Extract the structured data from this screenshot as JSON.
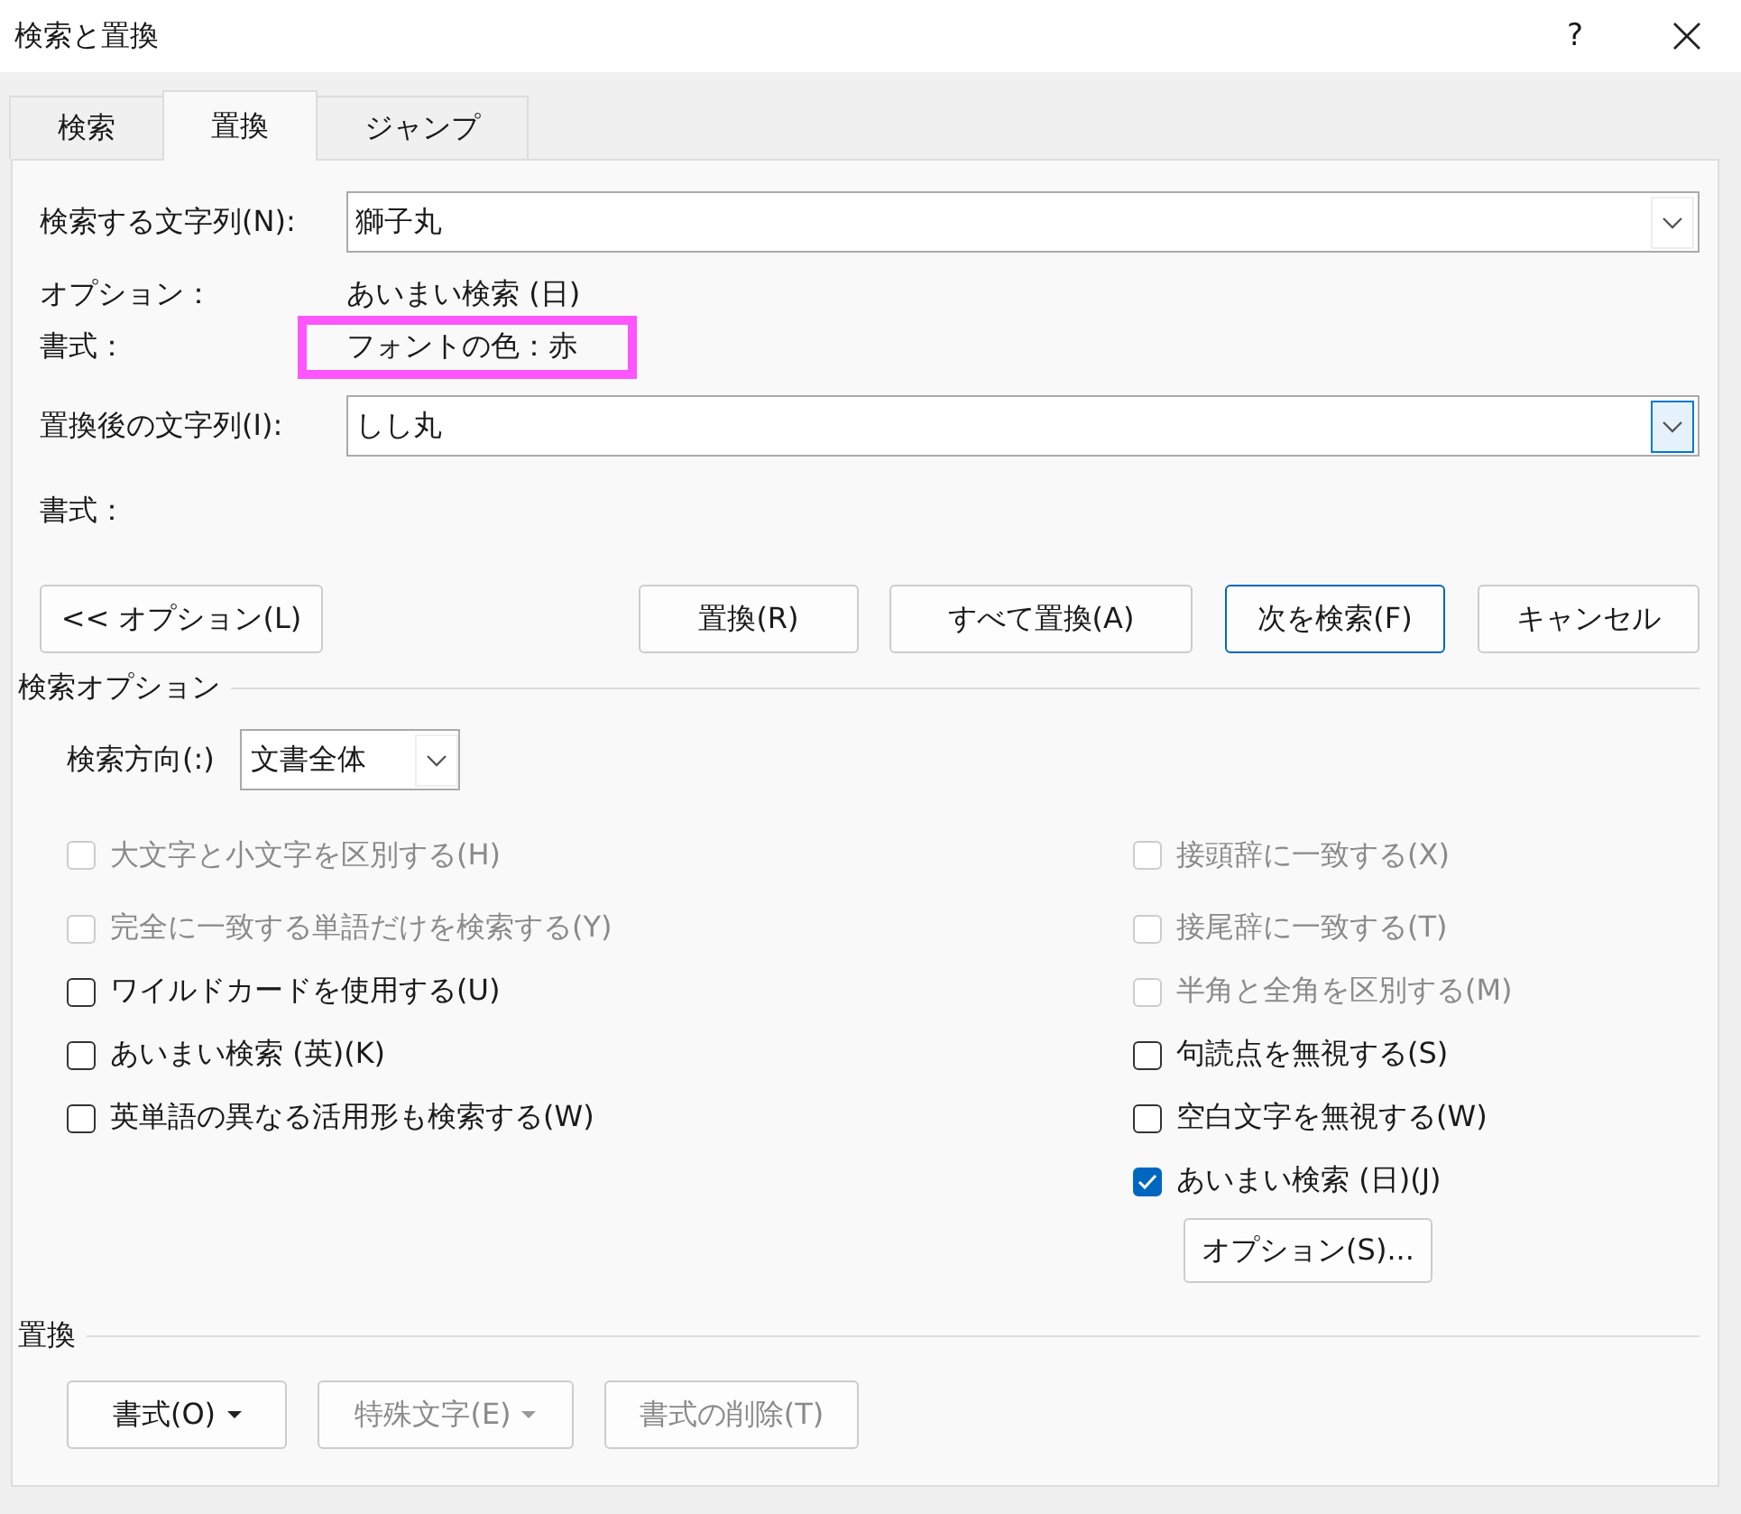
{
  "window": {
    "title": "検索と置換",
    "help": "?"
  },
  "tabs": [
    {
      "label": "検索",
      "selected": false
    },
    {
      "label": "置換",
      "selected": true
    },
    {
      "label": "ジャンプ",
      "selected": false
    }
  ],
  "find": {
    "label": "検索する文字列(N):",
    "value": "獅子丸",
    "focused": false
  },
  "find_options": {
    "label": "オプション：",
    "value": "あいまい検索 (日)"
  },
  "find_format": {
    "label": "書式：",
    "value": "フォントの色：赤",
    "highlighted": true
  },
  "replace": {
    "label": "置換後の文字列(I):",
    "value": "しし丸",
    "focused": true
  },
  "replace_format": {
    "label": "書式："
  },
  "options_toggle": {
    "label": "<< オプション(L)"
  },
  "buttons": [
    {
      "label": "置換(R)",
      "default": false
    },
    {
      "label": "すべて置換(A)",
      "default": false
    },
    {
      "label": "次を検索(F)",
      "default": true
    },
    {
      "label": "キャンセル",
      "default": false
    }
  ],
  "search_options": {
    "title": "検索オプション",
    "direction": {
      "label": "検索方向(:)",
      "value": "文書全体"
    },
    "left_checks": [
      {
        "label": "大文字と小文字を区別する(H)",
        "checked": false,
        "disabled": true
      },
      {
        "label": "完全に一致する単語だけを検索する(Y)",
        "checked": false,
        "disabled": true
      },
      {
        "label": "ワイルドカードを使用する(U)",
        "checked": false,
        "disabled": false
      },
      {
        "label": "あいまい検索 (英)(K)",
        "checked": false,
        "disabled": false
      },
      {
        "label": "英単語の異なる活用形も検索する(W)",
        "checked": false,
        "disabled": false
      }
    ],
    "right_checks": [
      {
        "label": "接頭辞に一致する(X)",
        "checked": false,
        "disabled": true
      },
      {
        "label": "接尾辞に一致する(T)",
        "checked": false,
        "disabled": true
      },
      {
        "label": "半角と全角を区別する(M)",
        "checked": false,
        "disabled": true
      },
      {
        "label": "句読点を無視する(S)",
        "checked": false,
        "disabled": false
      },
      {
        "label": "空白文字を無視する(W)",
        "checked": false,
        "disabled": false
      },
      {
        "label": "あいまい検索 (日)(J)",
        "checked": true,
        "disabled": false
      }
    ],
    "ime_button": {
      "label": "オプション(S)..."
    }
  },
  "replace_section": {
    "title": "置換",
    "buttons": [
      {
        "label": "書式(O)",
        "dropdown": true,
        "disabled": false
      },
      {
        "label": "特殊文字(E)",
        "dropdown": true,
        "disabled": true
      },
      {
        "label": "書式の削除(T)",
        "dropdown": false,
        "disabled": true
      }
    ]
  }
}
